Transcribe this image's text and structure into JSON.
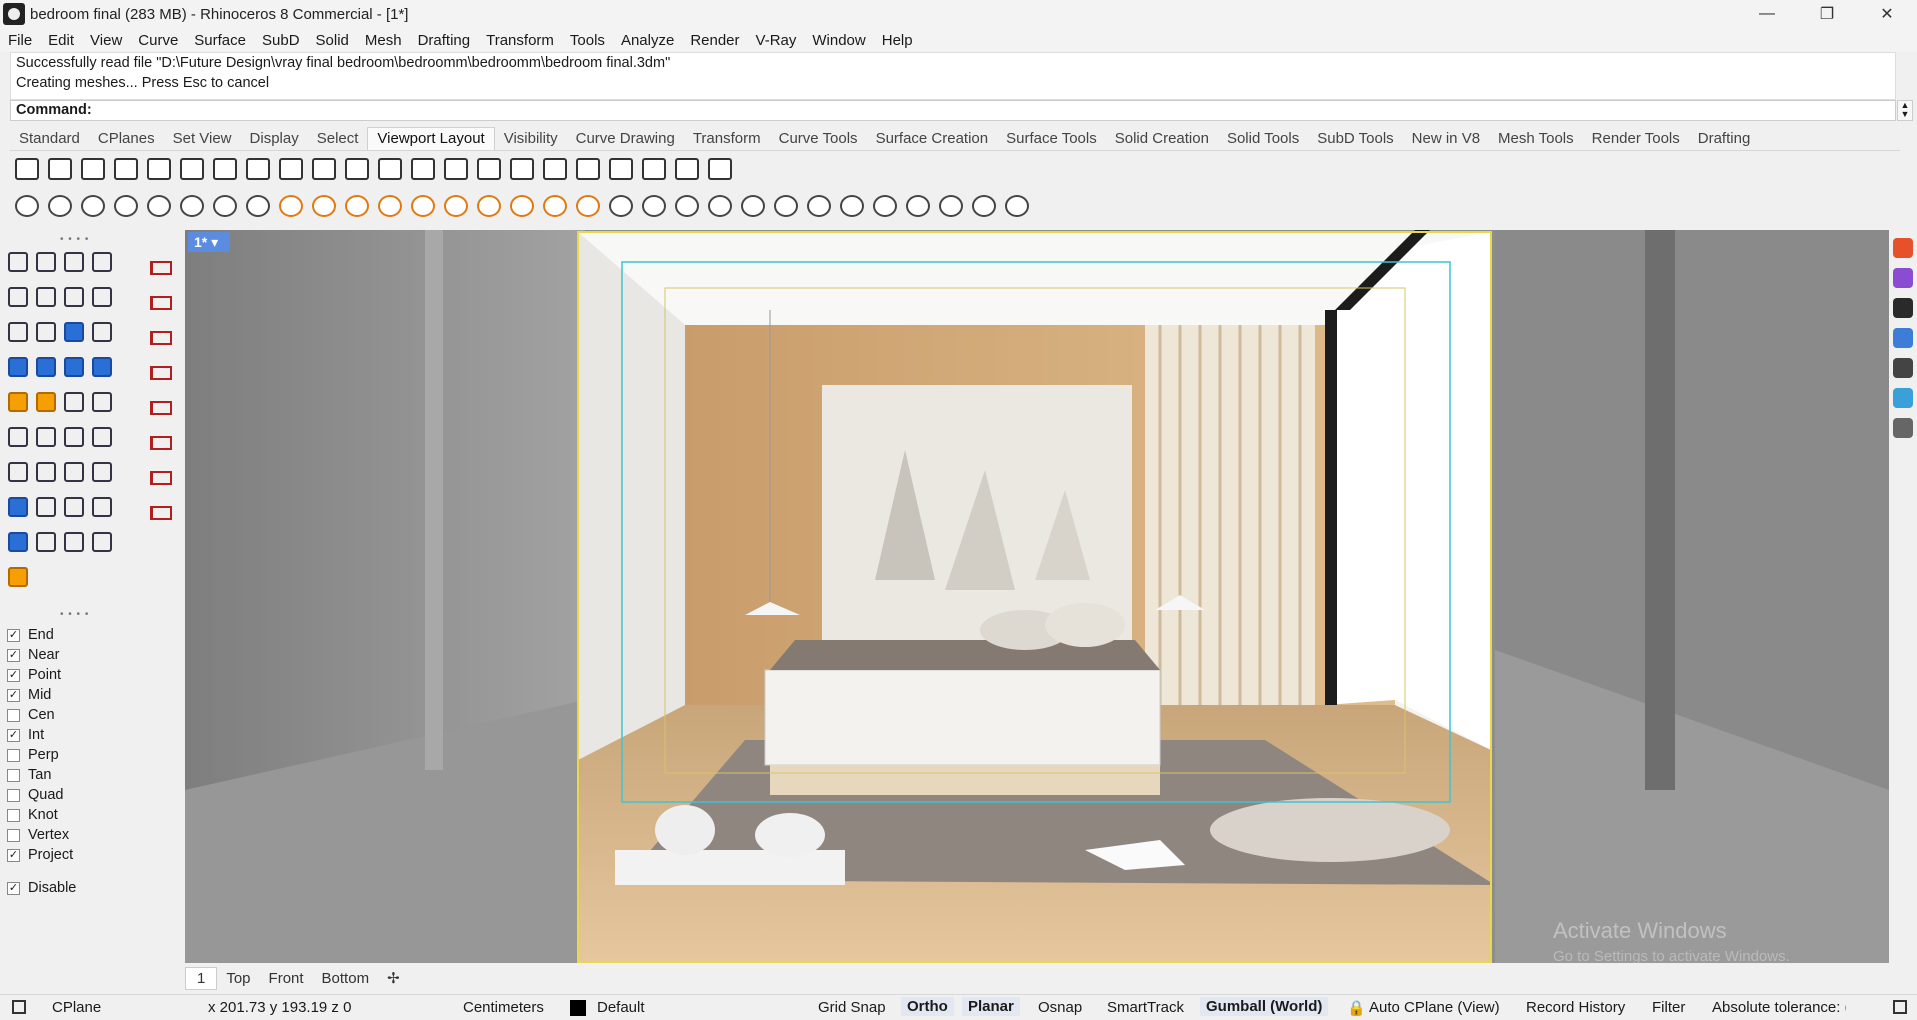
{
  "window": {
    "title": "bedroom final (283 MB) - Rhinoceros 8 Commercial - [1*]",
    "controls": [
      "—",
      "❐",
      "✕"
    ]
  },
  "menu": [
    "File",
    "Edit",
    "View",
    "Curve",
    "Surface",
    "SubD",
    "Solid",
    "Mesh",
    "Drafting",
    "Transform",
    "Tools",
    "Analyze",
    "Render",
    "V-Ray",
    "Window",
    "Help"
  ],
  "command_history": [
    "Successfully read file \"D:\\Future Design\\vray final bedroom\\bedroomm\\bedroomm\\bedroom final.3dm\"",
    "Creating meshes... Press Esc to cancel"
  ],
  "command": {
    "prompt": "Command:"
  },
  "toolbar_tabs": [
    "Standard",
    "CPlanes",
    "Set View",
    "Display",
    "Select",
    "Viewport Layout",
    "Visibility",
    "Curve Drawing",
    "Transform",
    "Curve Tools",
    "Surface Creation",
    "Surface Tools",
    "Solid Creation",
    "Solid Tools",
    "SubD Tools",
    "New in V8",
    "Mesh Tools",
    "Render Tools",
    "Drafting"
  ],
  "active_toolbar_tab": "Viewport Layout",
  "viewport": {
    "label": "1*"
  },
  "osnaps": [
    {
      "label": "End",
      "checked": true
    },
    {
      "label": "Near",
      "checked": true
    },
    {
      "label": "Point",
      "checked": true
    },
    {
      "label": "Mid",
      "checked": true
    },
    {
      "label": "Cen",
      "checked": false
    },
    {
      "label": "Int",
      "checked": true
    },
    {
      "label": "Perp",
      "checked": false
    },
    {
      "label": "Tan",
      "checked": false
    },
    {
      "label": "Quad",
      "checked": false
    },
    {
      "label": "Knot",
      "checked": false
    },
    {
      "label": "Vertex",
      "checked": false
    },
    {
      "label": "Project",
      "checked": true
    }
  ],
  "osnap_disable": {
    "label": "Disable",
    "checked": true
  },
  "viewport_tabs": [
    "1",
    "Top",
    "Front",
    "Bottom"
  ],
  "status": {
    "cplane": "CPlane",
    "coords": "x 201.73 y 193.19 z 0",
    "units": "Centimeters",
    "layer": "Default",
    "grid_snap": "Grid Snap",
    "ortho": "Ortho",
    "planar": "Planar",
    "osnap": "Osnap",
    "smarttrack": "SmartTrack",
    "gumball": "Gumball (World)",
    "auto_cplane": "Auto CPlane (View)",
    "record_history": "Record History",
    "filter": "Filter",
    "tolerance": "Absolute tolerance: ("
  },
  "activation": {
    "title": "Activate Windows",
    "subtitle": "Go to Settings to activate Windows."
  },
  "colors": {
    "viewport_label": "#5a8de0",
    "frame_yellow": "#e8d84a",
    "frame_cyan": "#3fc4d0"
  }
}
